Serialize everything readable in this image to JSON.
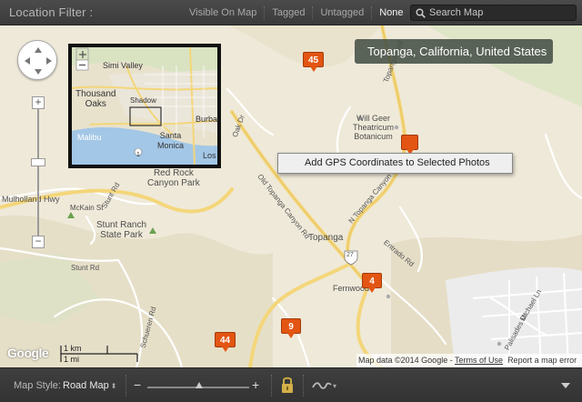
{
  "filter_bar": {
    "label": "Location Filter :",
    "options": [
      {
        "label": "Visible On Map",
        "active": false
      },
      {
        "label": "Tagged",
        "active": false
      },
      {
        "label": "Untagged",
        "active": false
      },
      {
        "label": "None",
        "active": true
      }
    ],
    "search_placeholder": "Search Map"
  },
  "map": {
    "location_tooltip": "Topanga, California, United States",
    "context_menu_item": "Add GPS Coordinates to Selected Photos",
    "markers": [
      {
        "count": "45"
      },
      {
        "count": "4"
      },
      {
        "count": "9"
      },
      {
        "count": "44"
      }
    ],
    "place_labels": {
      "red_rock": "Red Rock\nCanyon Park",
      "will_geer": "Will Geer\nTheatricum\nBotanicum",
      "stunt_ranch": "Stunt Ranch\nState Park",
      "topanga": "Topanga",
      "fernwood": "Fernwood",
      "mckain": "McKain St"
    },
    "road_labels": {
      "old_topanga": "Old Topanga Canyon Rd",
      "n_topanga": "N Topanga Canyon Blvd",
      "topanga_blvd": "Topanga Blvd",
      "stunt_rd": "Stunt Rd",
      "stunt_rd_2": "Stunt Rd",
      "schueren": "Schueren Rd",
      "entrado": "Entrado Rd",
      "oak_dr": "Oak Dr",
      "michael_ln": "Michael Ln",
      "palisades": "Palisades Dr",
      "mulholland": "Mulholland Hwy",
      "route": "27"
    },
    "inset_labels": {
      "simi": "Simi Valley",
      "thousand_oaks": "Thousand\nOaks",
      "shadow": "Shadow",
      "burbank": "Burba",
      "santa_monica": "Santa\nMonica",
      "malibu": "Malibu",
      "los": "Los",
      "route": "1"
    },
    "google_logo": "Google",
    "scale_km": "1 km",
    "scale_mi": "1 mi",
    "attribution": "Map data ©2014 Google - ",
    "terms": "Terms of Use",
    "report": "Report a map error"
  },
  "bottom_bar": {
    "map_style_label": "Map Style:",
    "map_style_value": "Road Map",
    "map_style_arrows": "⬍",
    "zoom_minus": "−",
    "zoom_plus": "+",
    "zoom_level": 0.51
  },
  "colors": {
    "marker": "#e35512",
    "water": "#a3c7e6",
    "road_major": "#f7d77a",
    "park": "#cfe1b4"
  }
}
